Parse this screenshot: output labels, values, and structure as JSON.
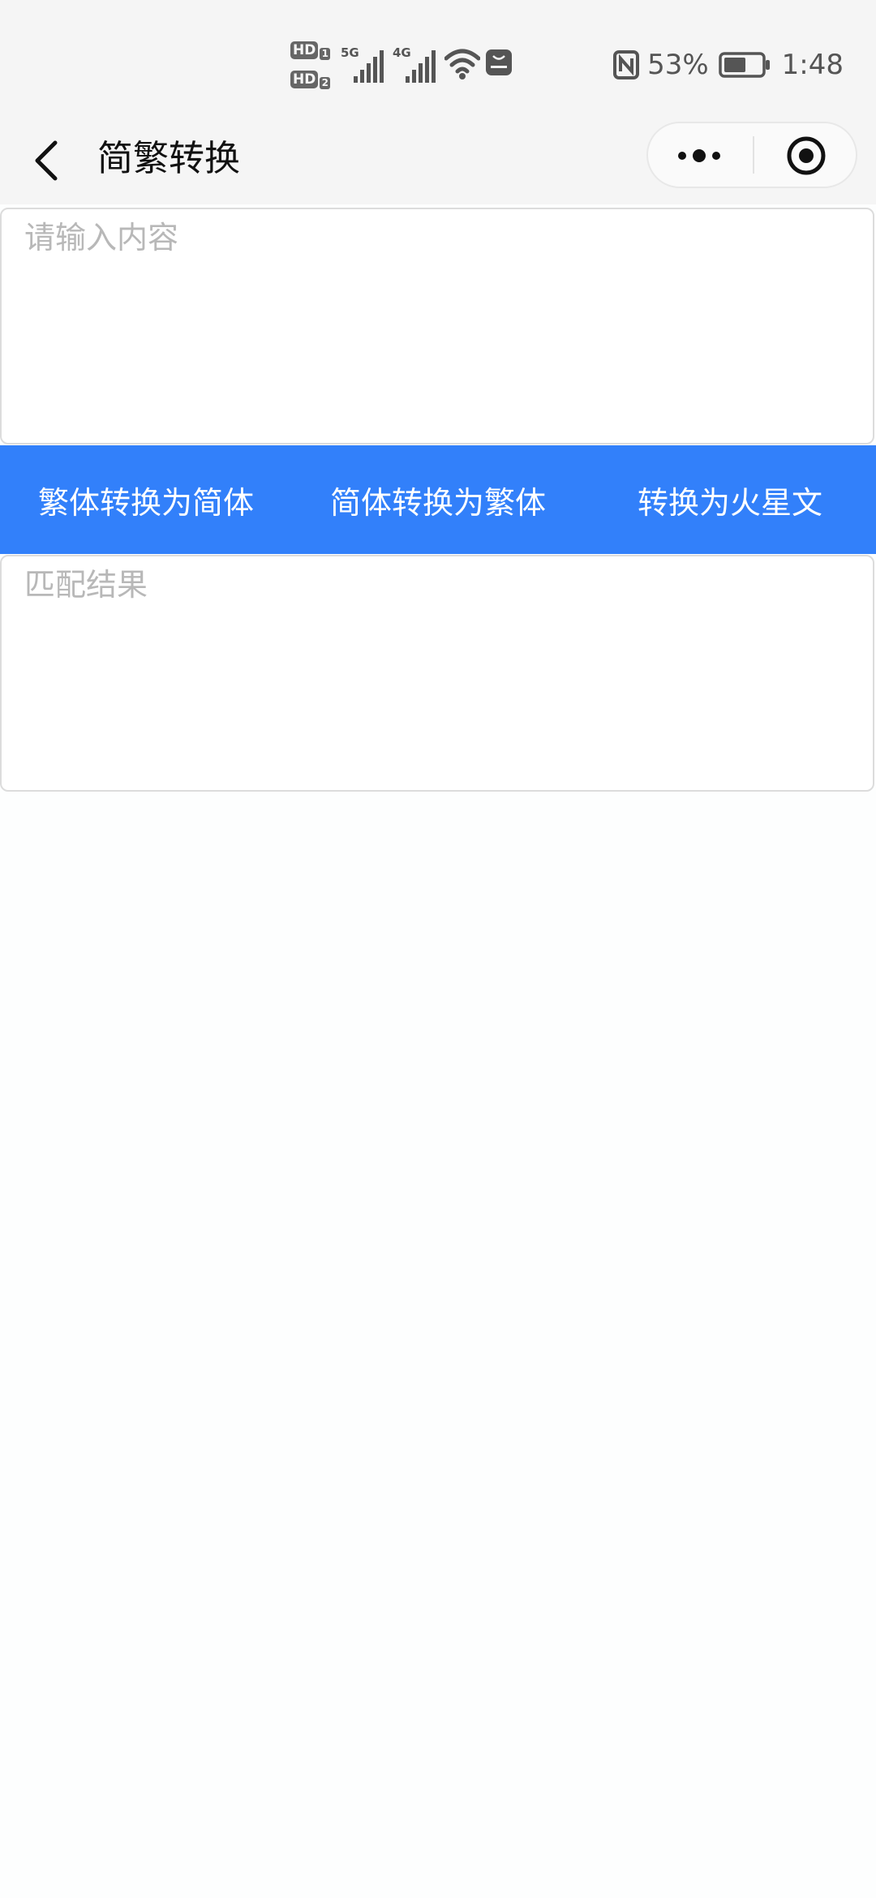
{
  "status_bar": {
    "hd1": "HD",
    "hd1_sim": "1",
    "hd2": "HD",
    "hd2_sim": "2",
    "network1": "5G",
    "network2": "4G",
    "battery_percent": "53%",
    "time": "1:48",
    "icons": [
      "hd-sim1-icon",
      "hd-sim2-icon",
      "signal-icon",
      "wifi-icon",
      "app-store-icon",
      "nfc-icon",
      "battery-icon"
    ]
  },
  "nav": {
    "title": "简繁转换",
    "back_icon": "chevron-left-icon",
    "capsule_more_icon": "more-dots-icon",
    "capsule_close_icon": "target-circle-icon"
  },
  "input": {
    "placeholder": "请输入内容",
    "value": ""
  },
  "actions": {
    "to_simplified": "繁体转换为简体",
    "to_traditional": "简体转换为繁体",
    "to_martian": "转换为火星文"
  },
  "result": {
    "placeholder": "匹配结果",
    "value": ""
  },
  "colors": {
    "accent": "#3280fa",
    "header_bg": "#f5f5f5",
    "placeholder": "#b8b8b8"
  }
}
